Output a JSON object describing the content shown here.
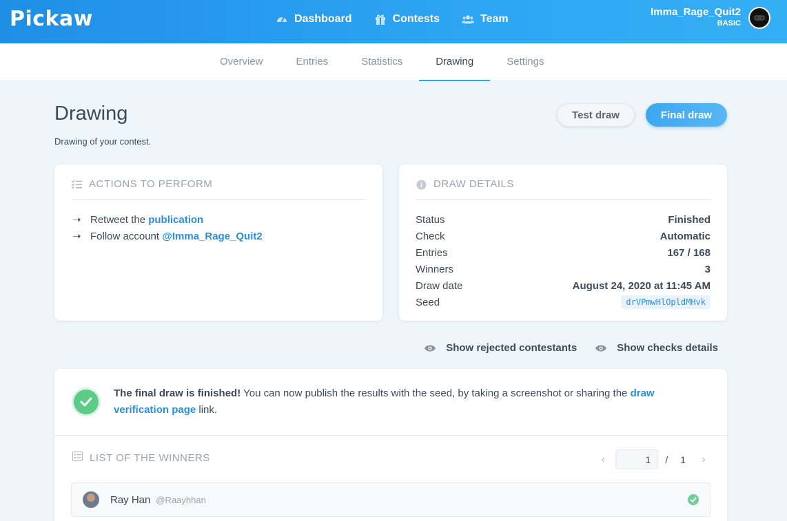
{
  "header": {
    "logo": "Pickaw",
    "nav": [
      {
        "label": "Dashboard",
        "icon": "gauge-icon"
      },
      {
        "label": "Contests",
        "icon": "gift-icon"
      },
      {
        "label": "Team",
        "icon": "users-icon"
      }
    ],
    "user": {
      "name": "Imma_Rage_Quit2",
      "plan": "BASIC"
    }
  },
  "tabs": [
    "Overview",
    "Entries",
    "Statistics",
    "Drawing",
    "Settings"
  ],
  "active_tab": "Drawing",
  "page": {
    "title": "Drawing",
    "subtitle": "Drawing of your contest.",
    "test_draw_label": "Test draw",
    "final_draw_label": "Final draw"
  },
  "actions": {
    "title": "ACTIONS TO PERFORM",
    "items": [
      {
        "text": "Retweet the ",
        "link": "publication"
      },
      {
        "text": "Follow account ",
        "link": "@Imma_Rage_Quit2"
      }
    ]
  },
  "details": {
    "title": "DRAW DETAILS",
    "rows": [
      {
        "label": "Status",
        "value": "Finished"
      },
      {
        "label": "Check",
        "value": "Automatic"
      },
      {
        "label": "Entries",
        "value": "167 / 168"
      },
      {
        "label": "Winners",
        "value": "3"
      },
      {
        "label": "Draw date",
        "value": "August 24, 2020 at 11:45 AM"
      },
      {
        "label": "Seed",
        "value": "drVPmwHlOpldMHvk"
      }
    ]
  },
  "toggles": {
    "rejected": "Show rejected contestants",
    "checks": "Show checks details"
  },
  "results": {
    "notice_bold": "The final draw is finished!",
    "notice_text": " You can now publish the results with the seed, by taking a screenshot or sharing the ",
    "notice_link": "draw verification page",
    "notice_end": " link.",
    "winners_title": "LIST OF THE WINNERS",
    "pager": {
      "current": "1",
      "separator": "/",
      "total": "1"
    },
    "winners": [
      {
        "name": "Ray Han",
        "handle": "@Raayhhan"
      }
    ]
  },
  "colors": {
    "primary": "#2ea5f3",
    "link": "#2a8fdc",
    "success": "#5ccb87"
  }
}
